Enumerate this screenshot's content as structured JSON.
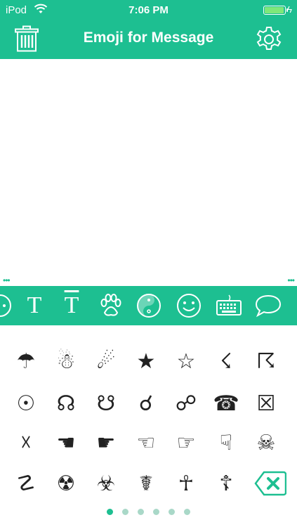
{
  "status": {
    "carrier": "iPod",
    "time": "7:06 PM",
    "battery_level": 1.0
  },
  "nav": {
    "title": "Emoji for Message"
  },
  "colors": {
    "accent": "#1dbf91",
    "text": "#222222"
  },
  "editor": {
    "value": "",
    "placeholder": ""
  },
  "scroll_indicators": {
    "left": "•••",
    "right": "•••"
  },
  "categories": [
    {
      "icon": "circle-partial-icon",
      "label": ""
    },
    {
      "icon": "serif-t-icon",
      "label": "T"
    },
    {
      "icon": "serif-t-overline-icon",
      "label": "T"
    },
    {
      "icon": "paw-icon",
      "label": ""
    },
    {
      "icon": "yin-yang-icon",
      "label": "☯"
    },
    {
      "icon": "smiley-icon",
      "label": "☺"
    },
    {
      "icon": "keyboard-icon",
      "label": "⌨"
    },
    {
      "icon": "speech-bubble-icon",
      "label": ""
    }
  ],
  "symbols": [
    [
      "☂",
      "☃",
      "☄",
      "★",
      "☆",
      "☇",
      "☈"
    ],
    [
      "☉",
      "☊",
      "☋",
      "☌",
      "☍",
      "☎",
      "☒"
    ],
    [
      "☓",
      "☚",
      "☛",
      "☜",
      "☞",
      "☟",
      "☠"
    ],
    [
      "☡",
      "☢",
      "☣",
      "☤",
      "☥",
      "☦",
      ""
    ]
  ],
  "pager": {
    "pages": 6,
    "active": 0
  }
}
